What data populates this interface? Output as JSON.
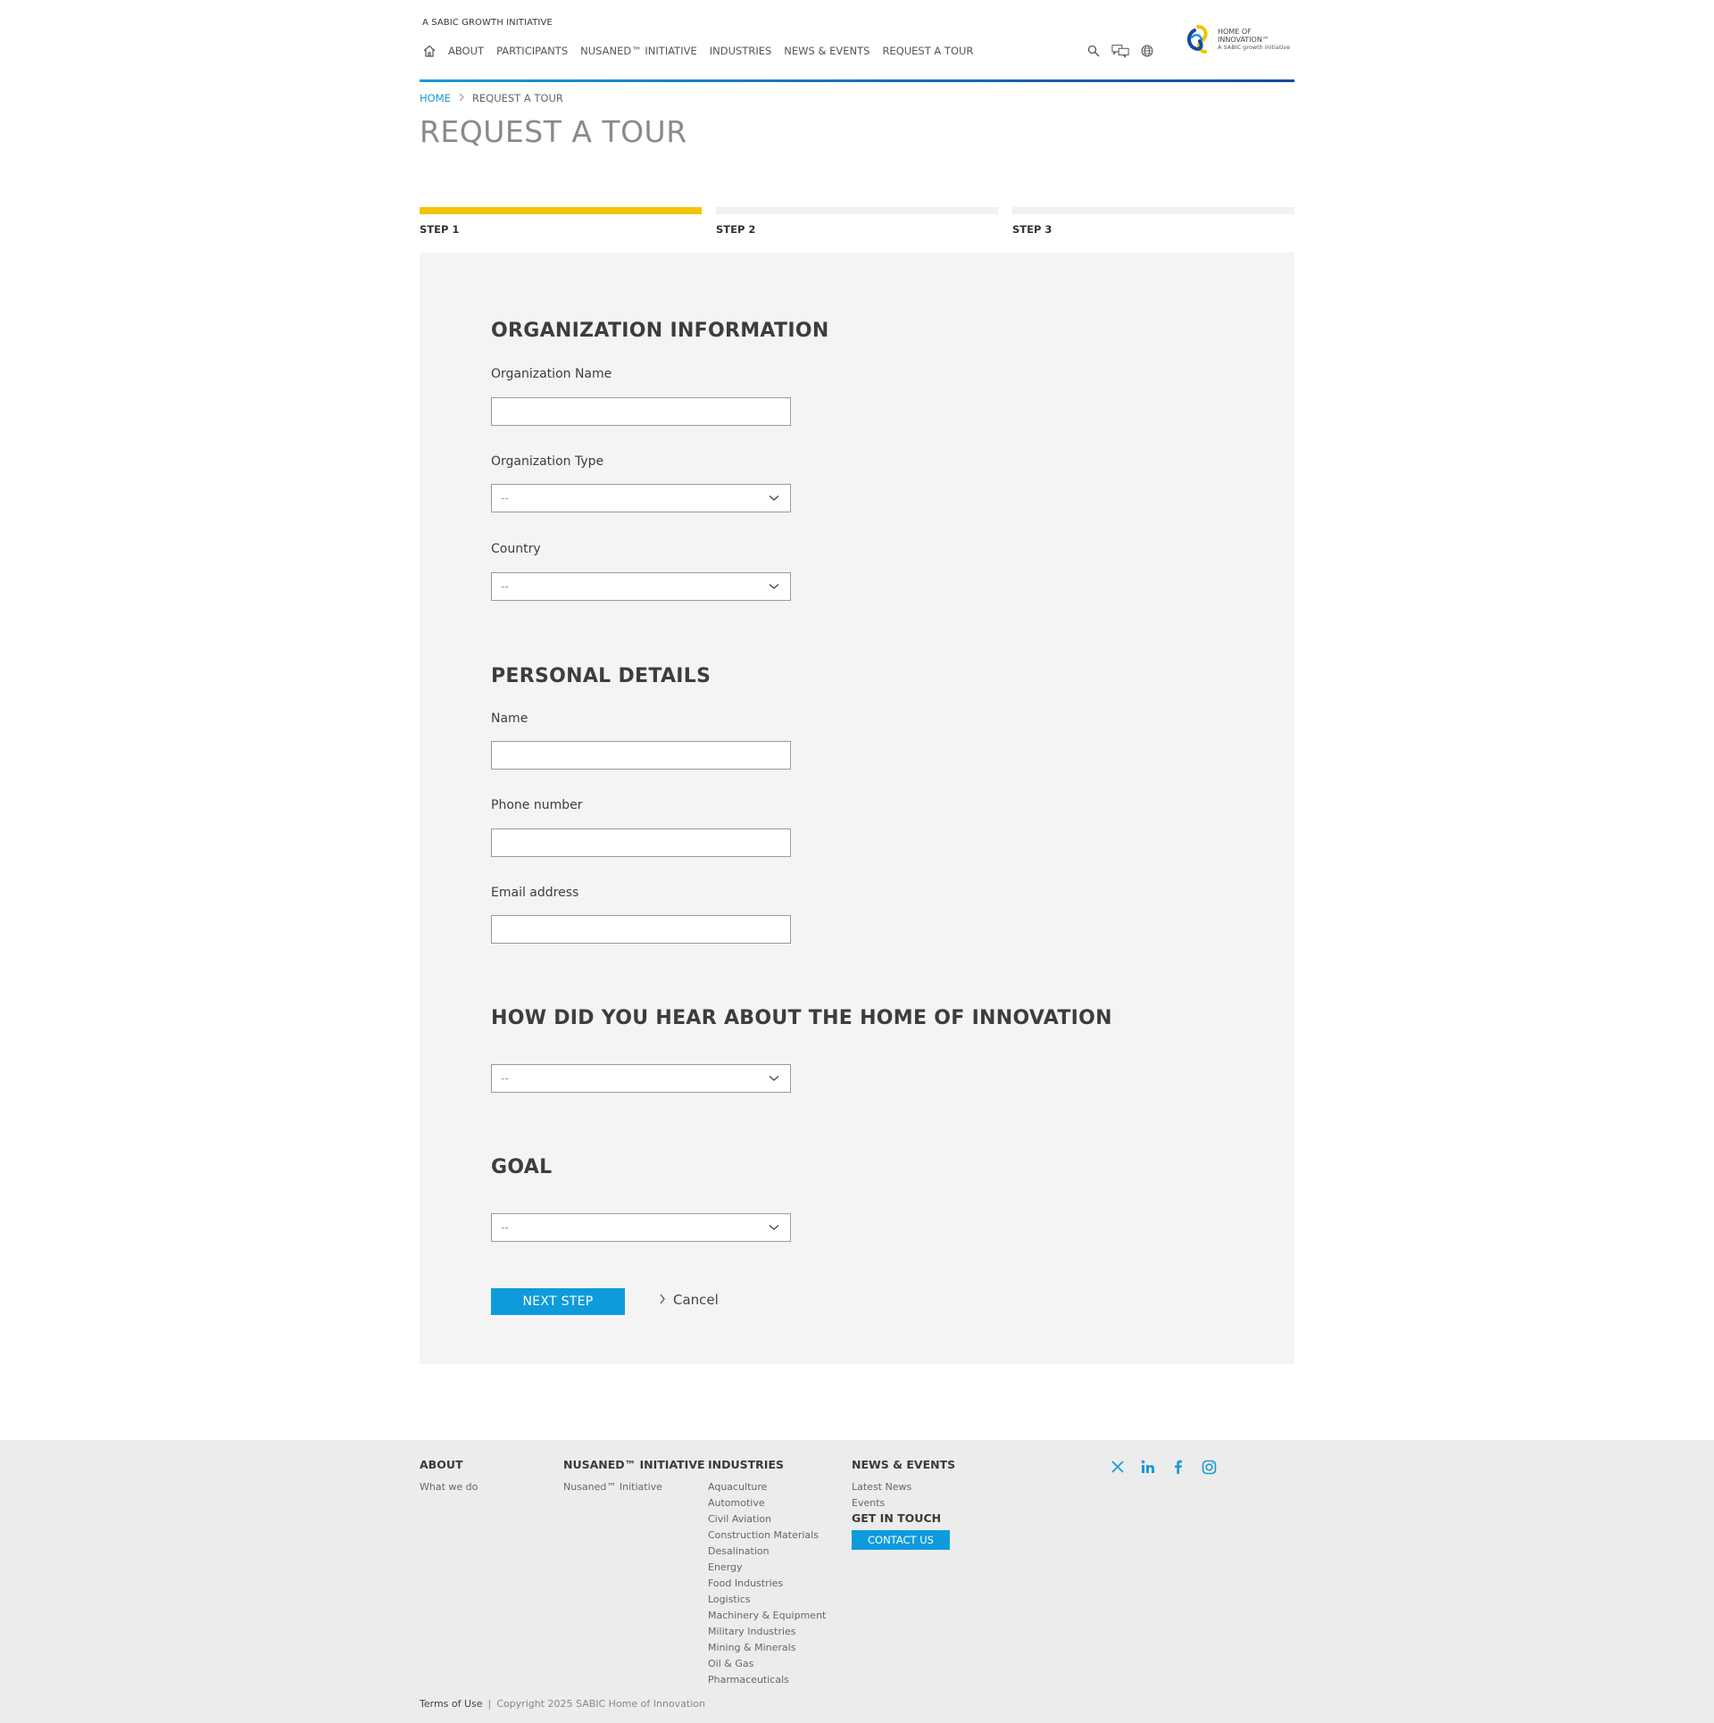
{
  "header": {
    "tagline": "A SABIC GROWTH INITIATIVE",
    "nav": [
      "ABOUT",
      "PARTICIPANTS",
      "NUSANED™ INITIATIVE",
      "INDUSTRIES",
      "NEWS & EVENTS",
      "REQUEST A TOUR"
    ],
    "logo_line1": "HOME OF",
    "logo_line2": "INNOVATION™",
    "logo_line3": "A SABIC growth initiative"
  },
  "breadcrumb": {
    "home": "HOME",
    "current": "REQUEST A TOUR"
  },
  "page_title": "REQUEST A TOUR",
  "steps": [
    "STEP 1",
    "STEP 2",
    "STEP 3"
  ],
  "form": {
    "org_section": "ORGANIZATION INFORMATION",
    "org_name_label": "Organization Name",
    "org_type_label": "Organization Type",
    "org_type_value": "--",
    "country_label": "Country",
    "country_value": "--",
    "personal_section": "PERSONAL DETAILS",
    "name_label": "Name",
    "phone_label": "Phone number",
    "email_label": "Email address",
    "hear_section": "HOW DID YOU HEAR ABOUT THE HOME OF INNOVATION",
    "hear_value": "--",
    "goal_section": "GOAL",
    "goal_value": "--",
    "next_button": "NEXT STEP",
    "cancel_link": "Cancel"
  },
  "footer": {
    "about": {
      "heading": "ABOUT",
      "links": [
        "What we do"
      ]
    },
    "nusaned": {
      "heading": "NUSANED™ INITIATIVE",
      "links": [
        "Nusaned™ Initiative"
      ]
    },
    "industries": {
      "heading": "INDUSTRIES",
      "links": [
        "Aquaculture",
        "Automotive",
        "Civil Aviation",
        "Construction Materials",
        "Desalination",
        "Energy",
        "Food Industries",
        "Logistics",
        "Machinery & Equipment",
        "Military Industries",
        "Mining & Minerals",
        "Oil & Gas",
        "Pharmaceuticals"
      ]
    },
    "news": {
      "heading": "NEWS & EVENTS",
      "links": [
        "Latest News",
        "Events"
      ]
    },
    "get_in_touch": "GET IN TOUCH",
    "contact_button": "CONTACT US",
    "terms": "Terms of Use",
    "separator": "|",
    "copyright": "Copyright 2025 SABIC Home of Innovation"
  },
  "colors": {
    "accent_blue": "#0e9bdc",
    "step_yellow": "#f3c300",
    "panel_bg": "#f4f4f4",
    "footer_bg": "#ececec"
  }
}
